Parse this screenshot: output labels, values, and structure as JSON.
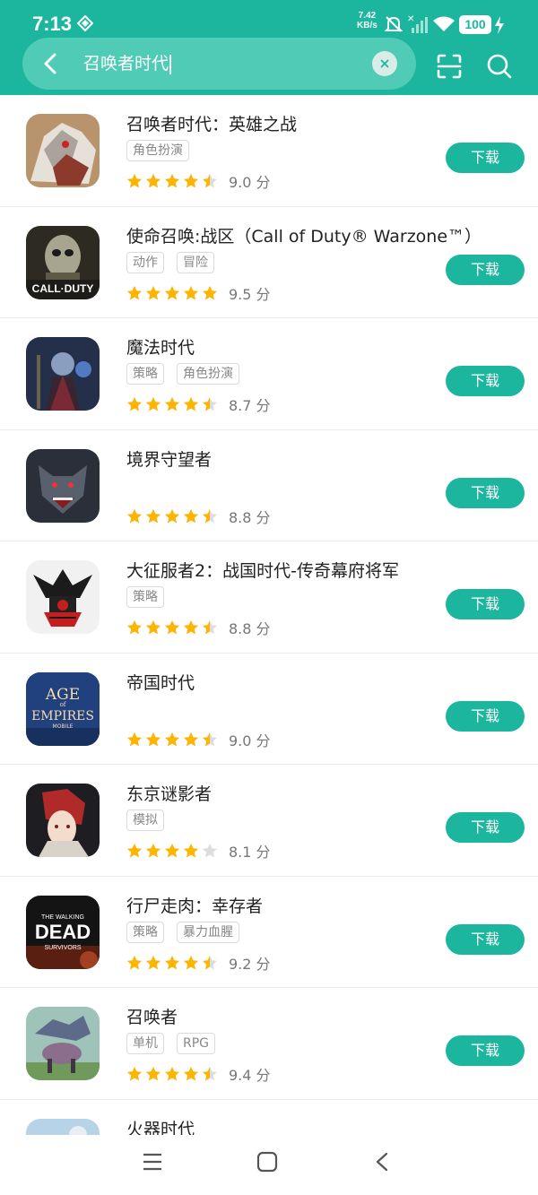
{
  "status_bar": {
    "time": "7:13",
    "net_speed": "7.42",
    "net_unit": "KB/s",
    "battery": "100"
  },
  "search": {
    "query": "召唤者时代"
  },
  "colors": {
    "accent": "#1cb69f",
    "star": "#ffb400",
    "star_empty": "#dddddd"
  },
  "apps": [
    {
      "name": "召唤者时代：英雄之战",
      "tags": [
        "角色扮演"
      ],
      "score": "9.0 分",
      "stars": 4.5,
      "button": "下载"
    },
    {
      "name": "使命召唤:战区（Call of Duty® Warzone™）",
      "tags": [
        "动作",
        "冒险"
      ],
      "score": "9.5 分",
      "stars": 5,
      "button": "下载"
    },
    {
      "name": "魔法时代",
      "tags": [
        "策略",
        "角色扮演"
      ],
      "score": "8.7 分",
      "stars": 4.5,
      "button": "下载"
    },
    {
      "name": "境界守望者",
      "tags": [],
      "score": "8.8 分",
      "stars": 4.5,
      "button": "下载"
    },
    {
      "name": "大征服者2：战国时代-传奇幕府将军",
      "tags": [
        "策略"
      ],
      "score": "8.8 分",
      "stars": 4.5,
      "button": "下载"
    },
    {
      "name": "帝国时代",
      "tags": [],
      "score": "9.0 分",
      "stars": 4.5,
      "button": "下载",
      "icon_text": [
        "AGE",
        "of",
        "EMPIRES",
        "MOBILE"
      ]
    },
    {
      "name": "东京谜影者",
      "tags": [
        "模拟"
      ],
      "score": "8.1 分",
      "stars": 4,
      "button": "下载"
    },
    {
      "name": "行尸走肉：幸存者",
      "tags": [
        "策略",
        "暴力血腥"
      ],
      "score": "9.2 分",
      "stars": 4.5,
      "button": "下载",
      "icon_text": [
        "THE WALKING",
        "DEAD",
        "SURVIVORS"
      ]
    },
    {
      "name": "召唤者",
      "tags": [
        "单机",
        "RPG"
      ],
      "score": "9.4 分",
      "stars": 4.5,
      "button": "下载"
    },
    {
      "name": "火器时代",
      "tags": [],
      "score": "",
      "stars": 0,
      "button": ""
    }
  ]
}
